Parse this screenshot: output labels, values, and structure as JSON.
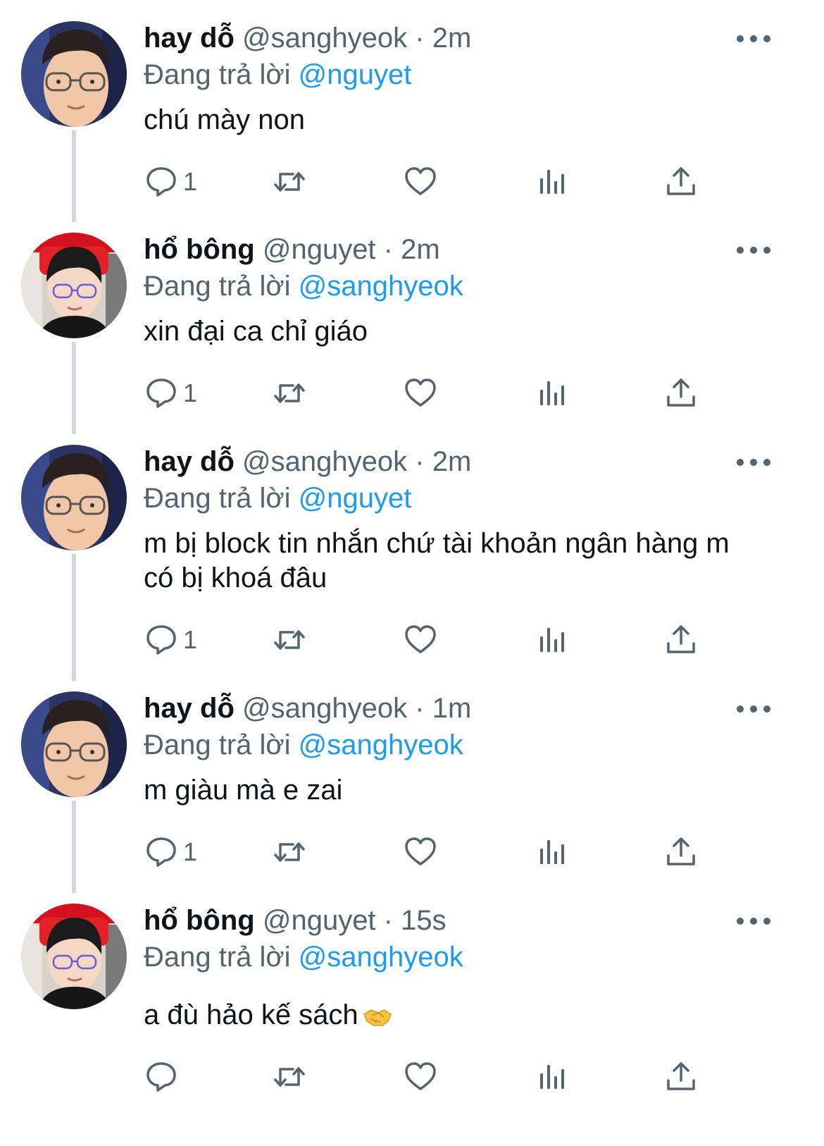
{
  "tweets": [
    {
      "display_name": "hay dỗ",
      "handle": "@sanghyeok",
      "separator": "·",
      "time": "2m",
      "replying_prefix": "Đang trả lời",
      "replying_to": "@nguyet",
      "text": "chú mày non",
      "reply_count": "1",
      "avatar": "avatar-glasses"
    },
    {
      "display_name": "hổ bông",
      "handle": "@nguyet",
      "separator": "·",
      "time": "2m",
      "replying_prefix": "Đang trả lời",
      "replying_to": "@sanghyeok",
      "text": "xin đại ca chỉ giáo",
      "reply_count": "1",
      "avatar": "avatar-gaming-chair"
    },
    {
      "display_name": "hay dỗ",
      "handle": "@sanghyeok",
      "separator": "·",
      "time": "2m",
      "replying_prefix": "Đang trả lời",
      "replying_to": "@nguyet",
      "text": "m bị block tin nhắn chứ tài khoản ngân hàng m có bị khoá đâu",
      "reply_count": "1",
      "avatar": "avatar-glasses"
    },
    {
      "display_name": "hay dỗ",
      "handle": "@sanghyeok",
      "separator": "·",
      "time": "1m",
      "replying_prefix": "Đang trả lời",
      "replying_to": "@sanghyeok",
      "text": "m giàu mà e zai",
      "reply_count": "1",
      "avatar": "avatar-glasses"
    },
    {
      "display_name": "hổ bông",
      "handle": "@nguyet",
      "separator": "·",
      "time": "15s",
      "replying_prefix": "Đang trả lời",
      "replying_to": "@sanghyeok",
      "text": "a đù hảo kế sách",
      "emoji": "handshake-emoji",
      "reply_count": "",
      "avatar": "avatar-gaming-chair"
    }
  ],
  "icons": {
    "reply": "reply-icon",
    "retweet": "retweet-icon",
    "like": "heart-icon",
    "views": "views-chart-icon",
    "share": "share-icon",
    "more": "more-icon"
  },
  "colors": {
    "text": "#0f1419",
    "secondary": "#536471",
    "link": "#1d9bf0",
    "thread_line": "#cfd9de"
  }
}
